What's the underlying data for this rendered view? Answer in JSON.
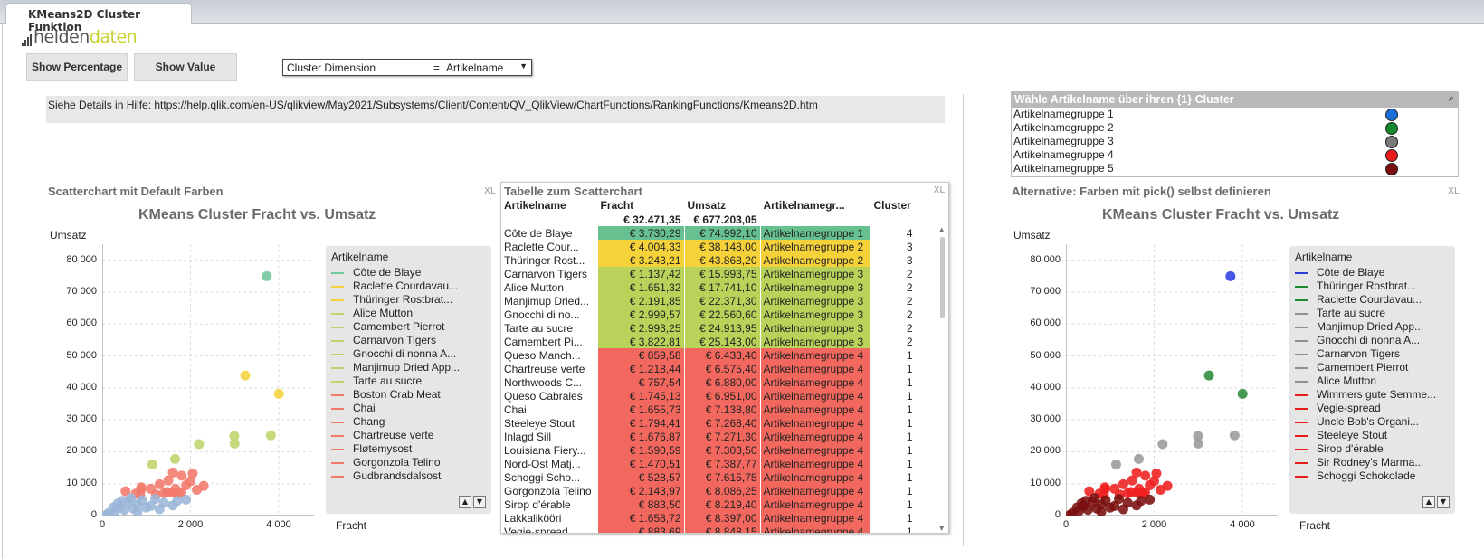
{
  "tab": {
    "title": "KMeans2D Cluster Funktion"
  },
  "logo": {
    "part1": "helden",
    "part2": "daten"
  },
  "buttons": {
    "show_percentage": "Show Percentage",
    "show_value": "Show Value"
  },
  "dropdown": {
    "label": "Cluster Dimension",
    "eq": "=",
    "value": "Artikelname"
  },
  "help_text": "Siehe Details in Hilfe: https://help.qlik.com/en-US/qlikview/May2021/Subsystems/Client/Content/QV_QlikView/ChartFunctions/RankingFunctions/Kmeans2D.htm",
  "selectbox": {
    "title": "Wähle Artikelname über ihren {1} Cluster",
    "items": [
      {
        "label": "Artikelnamegruppe 1",
        "color": "#1a6fd8"
      },
      {
        "label": "Artikelnamegruppe 2",
        "color": "#17892f"
      },
      {
        "label": "Artikelnamegruppe 3",
        "color": "#7a7a7a"
      },
      {
        "label": "Artikelnamegruppe 4",
        "color": "#e61b1b"
      },
      {
        "label": "Artikelnamegruppe 5",
        "color": "#7a0d0d"
      }
    ]
  },
  "left_chart": {
    "caption": "Scatterchart mit Default Farben",
    "xl": "XL",
    "title": "KMeans Cluster Fracht vs. Umsatz",
    "ylabel": "Umsatz",
    "xlabel": "Fracht",
    "yticks": [
      "80 000",
      "70 000",
      "60 000",
      "50 000",
      "40 000",
      "30 000",
      "20 000",
      "10 000",
      "0"
    ],
    "xticks": [
      "0",
      "2 000",
      "4 000"
    ],
    "legend_title": "Artikelname",
    "legend": [
      {
        "label": "Côte de Blaye",
        "color": "#72c79c"
      },
      {
        "label": "Raclette Courdavau...",
        "color": "#f5d33a"
      },
      {
        "label": "Thüringer Rostbrat...",
        "color": "#f5d33a"
      },
      {
        "label": "Alice Mutton",
        "color": "#bcd56a"
      },
      {
        "label": "Camembert Pierrot",
        "color": "#bcd56a"
      },
      {
        "label": "Carnarvon Tigers",
        "color": "#bcd56a"
      },
      {
        "label": "Gnocchi di nonna A...",
        "color": "#bcd56a"
      },
      {
        "label": "Manjimup Dried App...",
        "color": "#bcd56a"
      },
      {
        "label": "Tarte au sucre",
        "color": "#bcd56a"
      },
      {
        "label": "Boston Crab Meat",
        "color": "#f27a6c"
      },
      {
        "label": "Chai",
        "color": "#f27a6c"
      },
      {
        "label": "Chang",
        "color": "#f27a6c"
      },
      {
        "label": "Chartreuse verte",
        "color": "#f27a6c"
      },
      {
        "label": "Fløtemysost",
        "color": "#f27a6c"
      },
      {
        "label": "Gorgonzola Telino",
        "color": "#f27a6c"
      },
      {
        "label": "Gudbrandsdalsost",
        "color": "#f27a6c"
      }
    ]
  },
  "right_chart": {
    "caption": "Alternative: Farben mit pick() selbst definieren",
    "xl": "XL",
    "title": "KMeans Cluster Fracht vs. Umsatz",
    "ylabel": "Umsatz",
    "xlabel": "Fracht",
    "yticks": [
      "80 000",
      "70 000",
      "60 000",
      "50 000",
      "40 000",
      "30 000",
      "20 000",
      "10 000",
      "0"
    ],
    "xticks": [
      "0",
      "2 000",
      "4 000"
    ],
    "legend_title": "Artikelname",
    "legend": [
      {
        "label": "Côte de Blaye",
        "color": "#2b3bd8"
      },
      {
        "label": "Thüringer Rostbrat...",
        "color": "#1e8a2e"
      },
      {
        "label": "Raclette Courdavau...",
        "color": "#1e8a2e"
      },
      {
        "label": "Tarte au sucre",
        "color": "#8e8e8e"
      },
      {
        "label": "Manjimup Dried App...",
        "color": "#8e8e8e"
      },
      {
        "label": "Gnocchi di nonna A...",
        "color": "#8e8e8e"
      },
      {
        "label": "Carnarvon Tigers",
        "color": "#8e8e8e"
      },
      {
        "label": "Camembert Pierrot",
        "color": "#8e8e8e"
      },
      {
        "label": "Alice Mutton",
        "color": "#8e8e8e"
      },
      {
        "label": "Wimmers gute Semme...",
        "color": "#e81b1b"
      },
      {
        "label": "Vegie-spread",
        "color": "#e81b1b"
      },
      {
        "label": "Uncle Bob's Organi...",
        "color": "#e81b1b"
      },
      {
        "label": "Steeleye Stout",
        "color": "#e81b1b"
      },
      {
        "label": "Sirop d'érable",
        "color": "#e81b1b"
      },
      {
        "label": "Sir Rodney's Marma...",
        "color": "#e81b1b"
      },
      {
        "label": "Schoggi Schokolade",
        "color": "#e81b1b"
      }
    ]
  },
  "table": {
    "caption": "Tabelle zum Scatterchart",
    "xl": "XL",
    "headers": [
      "Artikelname",
      "Fracht",
      "Umsatz",
      "Artikelnamegr...",
      "Cluster"
    ],
    "totals": [
      "",
      "€ 32.471,35",
      "€ 677.203,05",
      "",
      ""
    ],
    "rows": [
      [
        "Côte de Blaye",
        "€ 3.730,29",
        "€ 74.992,10",
        "Artikelnamegruppe 1",
        "4"
      ],
      [
        "Raclette Cour...",
        "€ 4.004,33",
        "€ 38.148,00",
        "Artikelnamegruppe 2",
        "3"
      ],
      [
        "Thüringer Rost...",
        "€ 3.243,21",
        "€ 43.868,20",
        "Artikelnamegruppe 2",
        "3"
      ],
      [
        "Carnarvon Tigers",
        "€ 1.137,42",
        "€ 15.993,75",
        "Artikelnamegruppe 3",
        "2"
      ],
      [
        "Alice Mutton",
        "€ 1.651,32",
        "€ 17.741,10",
        "Artikelnamegruppe 3",
        "2"
      ],
      [
        "Manjimup Dried...",
        "€ 2.191,85",
        "€ 22.371,30",
        "Artikelnamegruppe 3",
        "2"
      ],
      [
        "Gnocchi di no...",
        "€ 2.999,57",
        "€ 22.560,60",
        "Artikelnamegruppe 3",
        "2"
      ],
      [
        "Tarte au sucre",
        "€ 2.993,25",
        "€ 24.913,95",
        "Artikelnamegruppe 3",
        "2"
      ],
      [
        "Camembert Pi...",
        "€ 3.822,81",
        "€ 25.143,00",
        "Artikelnamegruppe 3",
        "2"
      ],
      [
        "Queso Manch...",
        "€ 859,58",
        "€ 6.433,40",
        "Artikelnamegruppe 4",
        "1"
      ],
      [
        "Chartreuse verte",
        "€ 1.218,44",
        "€ 6.575,40",
        "Artikelnamegruppe 4",
        "1"
      ],
      [
        "Northwoods C...",
        "€ 757,54",
        "€ 6.880,00",
        "Artikelnamegruppe 4",
        "1"
      ],
      [
        "Queso Cabrales",
        "€ 1.745,13",
        "€ 6.951,00",
        "Artikelnamegruppe 4",
        "1"
      ],
      [
        "Chai",
        "€ 1.655,73",
        "€ 7.138,80",
        "Artikelnamegruppe 4",
        "1"
      ],
      [
        "Steeleye Stout",
        "€ 1.794,41",
        "€ 7.268,40",
        "Artikelnamegruppe 4",
        "1"
      ],
      [
        "Inlagd Sill",
        "€ 1.676,87",
        "€ 7.271,30",
        "Artikelnamegruppe 4",
        "1"
      ],
      [
        "Louisiana Fiery...",
        "€ 1.590,59",
        "€ 7.303,50",
        "Artikelnamegruppe 4",
        "1"
      ],
      [
        "Nord-Ost Matj...",
        "€ 1.470,51",
        "€ 7.387,77",
        "Artikelnamegruppe 4",
        "1"
      ],
      [
        "Schoggi Scho...",
        "€ 528,57",
        "€ 7.615,75",
        "Artikelnamegruppe 4",
        "1"
      ],
      [
        "Gorgonzola Telino",
        "€ 2.143,97",
        "€ 8.086,25",
        "Artikelnamegruppe 4",
        "1"
      ],
      [
        "Sirop d'érable",
        "€ 883,50",
        "€ 8.219,40",
        "Artikelnamegruppe 4",
        "1"
      ],
      [
        "Lakkalikööri",
        "€ 1.658,72",
        "€ 8.397,00",
        "Artikelnamegruppe 4",
        "1"
      ],
      [
        "Vegie-spread",
        "€ 883,69",
        "€ 8.848,15",
        "Artikelnamegruppe 4",
        "1"
      ]
    ],
    "group_colors": {
      "Artikelnamegruppe 1": "#67c08f",
      "Artikelnamegruppe 2": "#f6d23a",
      "Artikelnamegruppe 3": "#b9d35a",
      "Artikelnamegruppe 4": "#f2685e"
    }
  },
  "chart_data": [
    {
      "type": "scatter",
      "title": "KMeans Cluster Fracht vs. Umsatz",
      "xlabel": "Fracht",
      "ylabel": "Umsatz",
      "xlim": [
        0,
        4800
      ],
      "ylim": [
        0,
        85000
      ],
      "points": [
        {
          "x": 3730,
          "y": 74992,
          "c": "#72c79c"
        },
        {
          "x": 4004,
          "y": 38148,
          "c": "#f5d33a"
        },
        {
          "x": 3243,
          "y": 43868,
          "c": "#f5d33a"
        },
        {
          "x": 1137,
          "y": 15994,
          "c": "#bcd56a"
        },
        {
          "x": 1651,
          "y": 17741,
          "c": "#bcd56a"
        },
        {
          "x": 2192,
          "y": 22371,
          "c": "#bcd56a"
        },
        {
          "x": 3000,
          "y": 22561,
          "c": "#bcd56a"
        },
        {
          "x": 2993,
          "y": 24914,
          "c": "#bcd56a"
        },
        {
          "x": 3823,
          "y": 25143,
          "c": "#bcd56a"
        },
        {
          "x": 860,
          "y": 6433,
          "c": "#f27a6c"
        },
        {
          "x": 1218,
          "y": 6575,
          "c": "#f27a6c"
        },
        {
          "x": 758,
          "y": 6880,
          "c": "#f27a6c"
        },
        {
          "x": 1745,
          "y": 6951,
          "c": "#f27a6c"
        },
        {
          "x": 1656,
          "y": 7139,
          "c": "#f27a6c"
        },
        {
          "x": 1794,
          "y": 7268,
          "c": "#f27a6c"
        },
        {
          "x": 1677,
          "y": 7271,
          "c": "#f27a6c"
        },
        {
          "x": 1591,
          "y": 7304,
          "c": "#f27a6c"
        },
        {
          "x": 1471,
          "y": 7388,
          "c": "#f27a6c"
        },
        {
          "x": 529,
          "y": 7616,
          "c": "#f27a6c"
        },
        {
          "x": 2144,
          "y": 8086,
          "c": "#f27a6c"
        },
        {
          "x": 884,
          "y": 8219,
          "c": "#f27a6c"
        },
        {
          "x": 1659,
          "y": 8397,
          "c": "#f27a6c"
        },
        {
          "x": 884,
          "y": 8848,
          "c": "#f27a6c"
        },
        {
          "x": 1900,
          "y": 9500,
          "c": "#f27a6c"
        },
        {
          "x": 2300,
          "y": 9300,
          "c": "#f27a6c"
        },
        {
          "x": 1500,
          "y": 11000,
          "c": "#f27a6c"
        },
        {
          "x": 1800,
          "y": 12500,
          "c": "#f27a6c"
        },
        {
          "x": 2050,
          "y": 13200,
          "c": "#f27a6c"
        },
        {
          "x": 1600,
          "y": 13500,
          "c": "#f27a6c"
        },
        {
          "x": 1300,
          "y": 9800,
          "c": "#f27a6c"
        },
        {
          "x": 1100,
          "y": 8400,
          "c": "#f27a6c"
        },
        {
          "x": 1400,
          "y": 7000,
          "c": "#f27a6c"
        },
        {
          "x": 2000,
          "y": 10800,
          "c": "#f27a6c"
        },
        {
          "x": 1200,
          "y": 5200,
          "c": "#9bb5d8"
        },
        {
          "x": 600,
          "y": 4200,
          "c": "#9bb5d8"
        },
        {
          "x": 400,
          "y": 3000,
          "c": "#9bb5d8"
        },
        {
          "x": 800,
          "y": 3500,
          "c": "#9bb5d8"
        },
        {
          "x": 1000,
          "y": 2500,
          "c": "#9bb5d8"
        },
        {
          "x": 300,
          "y": 1500,
          "c": "#9bb5d8"
        },
        {
          "x": 150,
          "y": 800,
          "c": "#9bb5d8"
        },
        {
          "x": 500,
          "y": 1800,
          "c": "#9bb5d8"
        },
        {
          "x": 700,
          "y": 2200,
          "c": "#9bb5d8"
        },
        {
          "x": 900,
          "y": 4800,
          "c": "#9bb5d8"
        },
        {
          "x": 1400,
          "y": 4000,
          "c": "#9bb5d8"
        },
        {
          "x": 1600,
          "y": 3200,
          "c": "#9bb5d8"
        },
        {
          "x": 1900,
          "y": 5000,
          "c": "#9bb5d8"
        },
        {
          "x": 250,
          "y": 2500,
          "c": "#9bb5d8"
        },
        {
          "x": 450,
          "y": 4600,
          "c": "#9bb5d8"
        },
        {
          "x": 1100,
          "y": 3000,
          "c": "#9bb5d8"
        },
        {
          "x": 1300,
          "y": 2000,
          "c": "#9bb5d8"
        },
        {
          "x": 650,
          "y": 5500,
          "c": "#9bb5d8"
        },
        {
          "x": 350,
          "y": 3800,
          "c": "#9bb5d8"
        },
        {
          "x": 1700,
          "y": 4600,
          "c": "#9bb5d8"
        },
        {
          "x": 100,
          "y": 300,
          "c": "#9bb5d8"
        },
        {
          "x": 800,
          "y": 1200,
          "c": "#9bb5d8"
        }
      ]
    },
    {
      "type": "scatter",
      "title": "KMeans Cluster Fracht vs. Umsatz",
      "xlabel": "Fracht",
      "ylabel": "Umsatz",
      "xlim": [
        0,
        4800
      ],
      "ylim": [
        0,
        85000
      ],
      "points": [
        {
          "x": 3730,
          "y": 74992,
          "c": "#2e3fe6"
        },
        {
          "x": 4004,
          "y": 38148,
          "c": "#2e8b3a"
        },
        {
          "x": 3243,
          "y": 43868,
          "c": "#2e8b3a"
        },
        {
          "x": 1137,
          "y": 15994,
          "c": "#9a9a9a"
        },
        {
          "x": 1651,
          "y": 17741,
          "c": "#9a9a9a"
        },
        {
          "x": 2192,
          "y": 22371,
          "c": "#9a9a9a"
        },
        {
          "x": 3000,
          "y": 22561,
          "c": "#9a9a9a"
        },
        {
          "x": 2993,
          "y": 24914,
          "c": "#9a9a9a"
        },
        {
          "x": 3823,
          "y": 25143,
          "c": "#9a9a9a"
        },
        {
          "x": 860,
          "y": 6433,
          "c": "#ef2020"
        },
        {
          "x": 1218,
          "y": 6575,
          "c": "#ef2020"
        },
        {
          "x": 758,
          "y": 6880,
          "c": "#ef2020"
        },
        {
          "x": 1745,
          "y": 6951,
          "c": "#ef2020"
        },
        {
          "x": 1656,
          "y": 7139,
          "c": "#ef2020"
        },
        {
          "x": 1794,
          "y": 7268,
          "c": "#ef2020"
        },
        {
          "x": 1677,
          "y": 7271,
          "c": "#ef2020"
        },
        {
          "x": 1591,
          "y": 7304,
          "c": "#ef2020"
        },
        {
          "x": 1471,
          "y": 7388,
          "c": "#ef2020"
        },
        {
          "x": 529,
          "y": 7616,
          "c": "#ef2020"
        },
        {
          "x": 2144,
          "y": 8086,
          "c": "#ef2020"
        },
        {
          "x": 884,
          "y": 8219,
          "c": "#ef2020"
        },
        {
          "x": 1659,
          "y": 8397,
          "c": "#ef2020"
        },
        {
          "x": 884,
          "y": 8848,
          "c": "#ef2020"
        },
        {
          "x": 1900,
          "y": 9500,
          "c": "#ef2020"
        },
        {
          "x": 2300,
          "y": 9300,
          "c": "#ef2020"
        },
        {
          "x": 1500,
          "y": 11000,
          "c": "#ef2020"
        },
        {
          "x": 1800,
          "y": 12500,
          "c": "#ef2020"
        },
        {
          "x": 2050,
          "y": 13200,
          "c": "#ef2020"
        },
        {
          "x": 1600,
          "y": 13500,
          "c": "#ef2020"
        },
        {
          "x": 1300,
          "y": 9800,
          "c": "#ef2020"
        },
        {
          "x": 1100,
          "y": 8400,
          "c": "#ef2020"
        },
        {
          "x": 1400,
          "y": 7000,
          "c": "#ef2020"
        },
        {
          "x": 2000,
          "y": 10800,
          "c": "#ef2020"
        },
        {
          "x": 1200,
          "y": 5200,
          "c": "#7a0f0f"
        },
        {
          "x": 600,
          "y": 4200,
          "c": "#7a0f0f"
        },
        {
          "x": 400,
          "y": 3000,
          "c": "#7a0f0f"
        },
        {
          "x": 800,
          "y": 3500,
          "c": "#7a0f0f"
        },
        {
          "x": 1000,
          "y": 2500,
          "c": "#7a0f0f"
        },
        {
          "x": 300,
          "y": 1500,
          "c": "#7a0f0f"
        },
        {
          "x": 150,
          "y": 800,
          "c": "#7a0f0f"
        },
        {
          "x": 500,
          "y": 1800,
          "c": "#7a0f0f"
        },
        {
          "x": 700,
          "y": 2200,
          "c": "#7a0f0f"
        },
        {
          "x": 900,
          "y": 4800,
          "c": "#7a0f0f"
        },
        {
          "x": 1400,
          "y": 4000,
          "c": "#7a0f0f"
        },
        {
          "x": 1600,
          "y": 3200,
          "c": "#7a0f0f"
        },
        {
          "x": 1900,
          "y": 5000,
          "c": "#7a0f0f"
        },
        {
          "x": 250,
          "y": 2500,
          "c": "#7a0f0f"
        },
        {
          "x": 450,
          "y": 4600,
          "c": "#7a0f0f"
        },
        {
          "x": 1100,
          "y": 3000,
          "c": "#7a0f0f"
        },
        {
          "x": 1300,
          "y": 2000,
          "c": "#7a0f0f"
        },
        {
          "x": 650,
          "y": 5500,
          "c": "#7a0f0f"
        },
        {
          "x": 350,
          "y": 3800,
          "c": "#7a0f0f"
        },
        {
          "x": 1700,
          "y": 4600,
          "c": "#7a0f0f"
        },
        {
          "x": 100,
          "y": 300,
          "c": "#7a0f0f"
        },
        {
          "x": 800,
          "y": 1200,
          "c": "#7a0f0f"
        }
      ]
    }
  ]
}
